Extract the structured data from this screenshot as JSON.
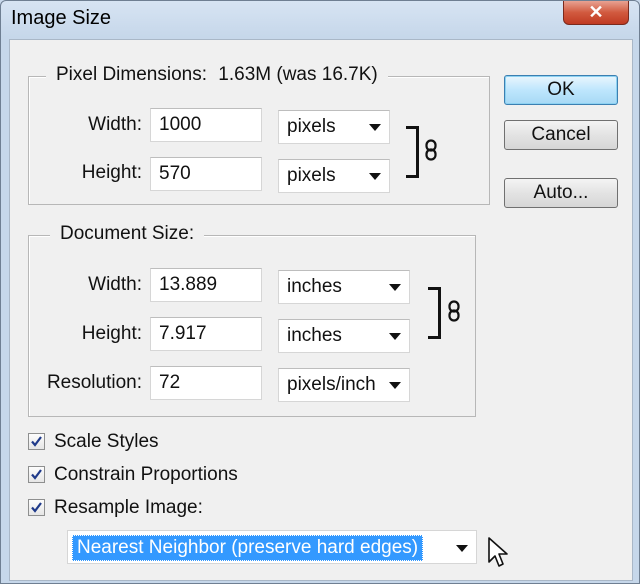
{
  "window": {
    "title": "Image Size",
    "close_label": "✕"
  },
  "pixel_dimensions": {
    "legend": "Pixel Dimensions:",
    "size_text": "1.63M (was 16.7K)",
    "width_label": "Width:",
    "width_value": "1000",
    "width_unit": "pixels",
    "height_label": "Height:",
    "height_value": "570",
    "height_unit": "pixels"
  },
  "document_size": {
    "legend": "Document Size:",
    "width_label": "Width:",
    "width_value": "13.889",
    "width_unit": "inches",
    "height_label": "Height:",
    "height_value": "7.917",
    "height_unit": "inches",
    "resolution_label": "Resolution:",
    "resolution_value": "72",
    "resolution_unit": "pixels/inch"
  },
  "buttons": {
    "ok": "OK",
    "cancel": "Cancel",
    "auto": "Auto..."
  },
  "options": {
    "scale_styles": {
      "label": "Scale Styles",
      "checked": true
    },
    "constrain_proportions": {
      "label": "Constrain Proportions",
      "checked": true
    },
    "resample_image": {
      "label": "Resample Image:",
      "checked": true
    }
  },
  "resample_method": "Nearest Neighbor (preserve hard edges)",
  "colors": {
    "selection": "#3399ff",
    "titlebar": "#c6d7ea",
    "close": "#c03a22"
  }
}
